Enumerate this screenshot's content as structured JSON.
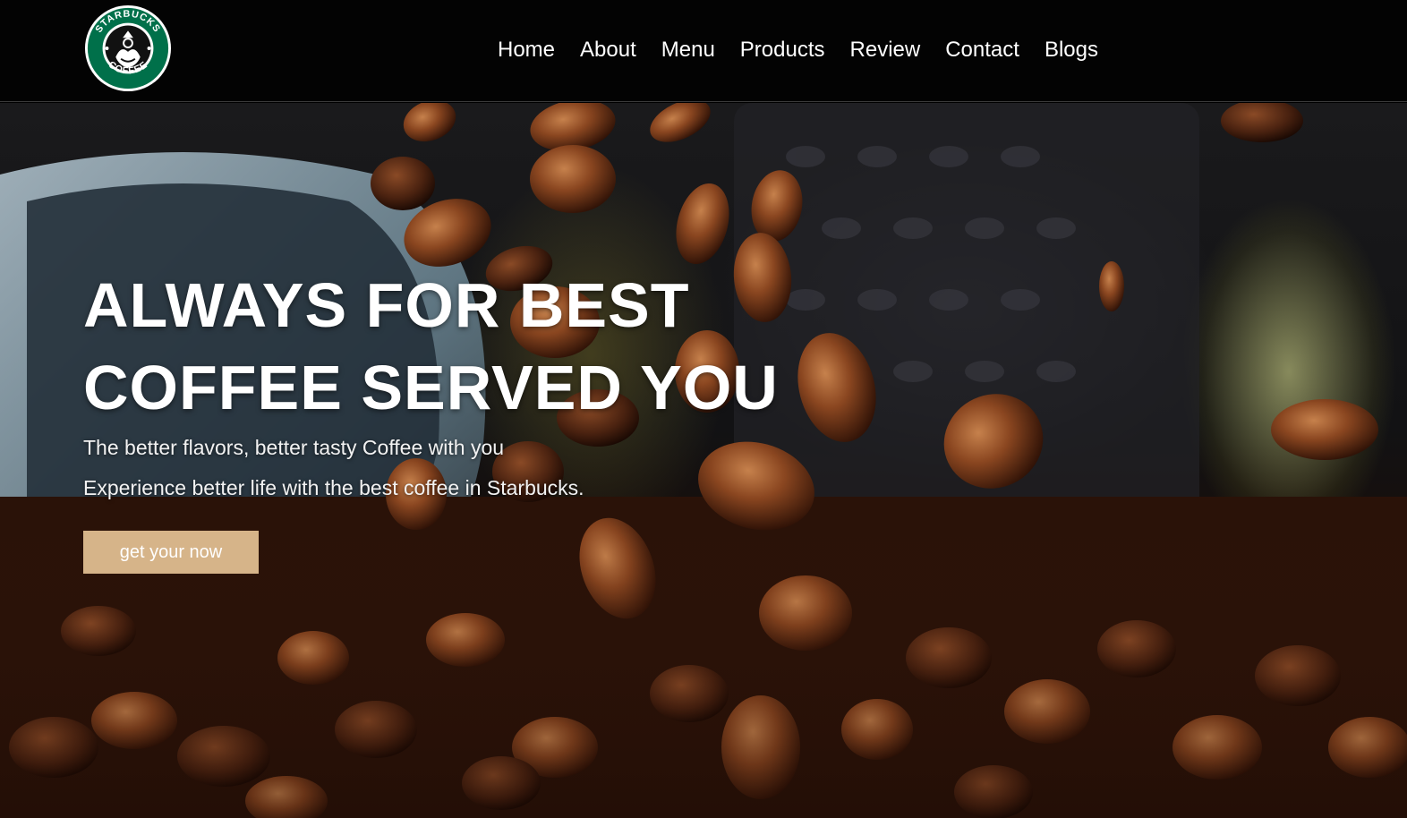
{
  "header": {
    "logo_alt": "Starbucks Coffee",
    "nav": [
      "Home",
      "About",
      "Menu",
      "Products",
      "Review",
      "Contact",
      "Blogs"
    ]
  },
  "hero": {
    "headline_line1": "ALWAYS FOR BEST",
    "headline_line2": "COFFEE SERVED YOU",
    "subtitle_line1": "The better flavors, better tasty Coffee with you",
    "subtitle_line2": "Experience better life with the best coffee in Starbucks.",
    "cta_label": "get your now"
  },
  "colors": {
    "header_bg": "#030303",
    "cta_bg": "#d6b489",
    "logo_green": "#00704a"
  },
  "icons": {
    "logo": "starbucks-siren-logo"
  }
}
